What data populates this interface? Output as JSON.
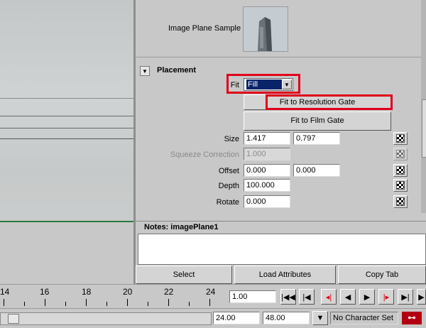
{
  "image_plane": {
    "sample_label": "Image Plane Sample"
  },
  "placement": {
    "title": "Placement",
    "fit_label": "Fit",
    "fit_value": "Fill",
    "fit_to_resolution_gate": "Fit to Resolution Gate",
    "fit_to_film_gate": "Fit to Film Gate",
    "size_label": "Size",
    "size_x": "1.417",
    "size_y": "0.797",
    "squeeze_label": "Squeeze Correction",
    "squeeze_value": "1.000",
    "offset_label": "Offset",
    "offset_x": "0.000",
    "offset_y": "0.000",
    "depth_label": "Depth",
    "depth_value": "100.000",
    "rotate_label": "Rotate",
    "rotate_value": "0.000"
  },
  "notes": {
    "label": "Notes:  imagePlane1"
  },
  "buttons": {
    "select": "Select",
    "load_attributes": "Load Attributes",
    "copy_tab": "Copy Tab"
  },
  "timeline": {
    "ticks": [
      "14",
      "16",
      "18",
      "20",
      "22",
      "24"
    ],
    "current_frame": "1.00"
  },
  "range": {
    "end_time": "24.00",
    "playback_end": "48.00",
    "character_set": "No Character Set"
  },
  "icons": {
    "collapse": "collapse-arrow-icon",
    "map": "checker-map-icon",
    "dropdown": "dropdown-arrow-icon"
  },
  "colors": {
    "highlight": "#e0001a",
    "selection": "#0a246a",
    "grid_line": "#2b7a3a"
  }
}
